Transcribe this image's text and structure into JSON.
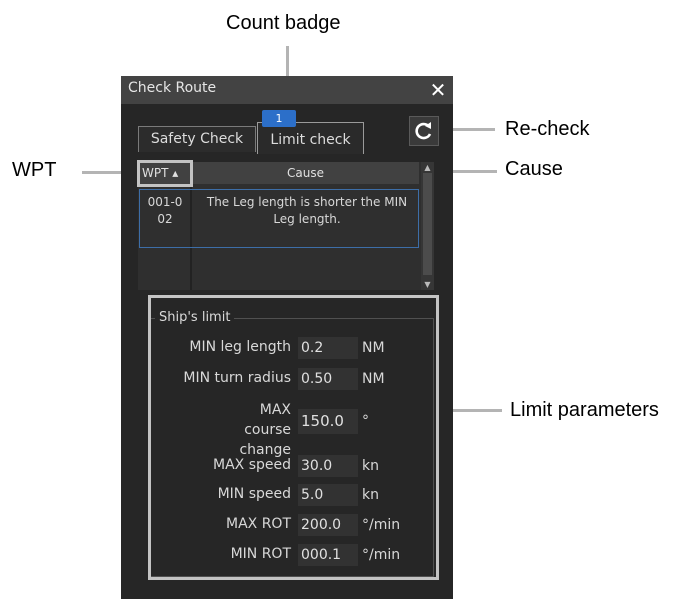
{
  "callouts": {
    "count_badge": "Count badge",
    "recheck": "Re-check",
    "wpt": "WPT",
    "cause": "Cause",
    "limit_parameters": "Limit parameters"
  },
  "window": {
    "title": "Check Route",
    "close_glyph": "✕",
    "tabs": [
      {
        "label": "Safety Check",
        "selected": false
      },
      {
        "label": "Limit check",
        "selected": true
      }
    ],
    "badge_count": "1",
    "recheck_icon": "refresh-icon"
  },
  "table": {
    "headers": {
      "wpt": "WPT ▴",
      "cause": "Cause"
    },
    "rows": [
      {
        "wpt": "001-0 02",
        "cause": "The Leg length is shorter the MIN Leg length."
      }
    ]
  },
  "ship_limit": {
    "legend": "Ship's limit",
    "params": [
      {
        "label": "MIN leg length",
        "value": "0.2",
        "unit": "NM"
      },
      {
        "label": "MIN turn radius",
        "value": "0.50",
        "unit": "NM"
      },
      {
        "label": "MAX course change",
        "value": "150.0",
        "unit": "°"
      },
      {
        "label": "MAX speed",
        "value": "30.0",
        "unit": "kn"
      },
      {
        "label": "MIN speed",
        "value": "5.0",
        "unit": "kn"
      },
      {
        "label": "MAX ROT",
        "value": "200.0",
        "unit": "°/min"
      },
      {
        "label": "MIN ROT",
        "value": "000.1",
        "unit": "°/min"
      }
    ]
  },
  "colors": {
    "window_bg": "#262626",
    "titlebar_bg": "#434343",
    "badge_bg": "#2c6fc9",
    "row_border": "#3d6ea8",
    "highlight": "#c3c3c3"
  }
}
